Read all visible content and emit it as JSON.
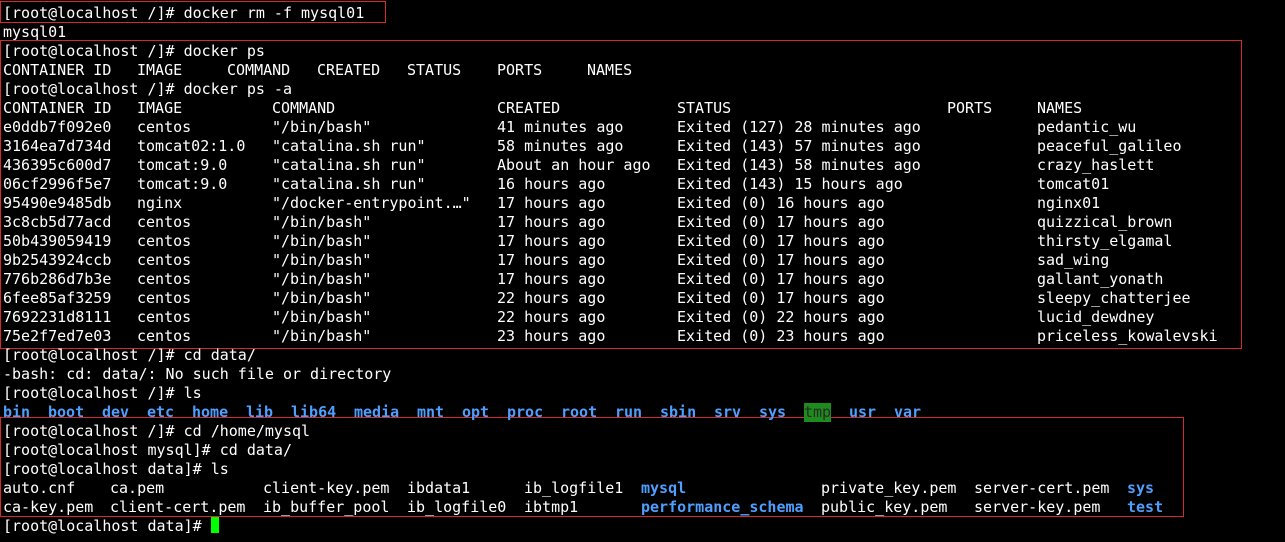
{
  "terminal": {
    "prompt_root": "[root@localhost /]#",
    "prompt_mysql": "[root@localhost mysql]#",
    "prompt_data": "[root@localhost data]#",
    "accent_color": "#d42a2a",
    "dir_color": "#4f9fff",
    "cursor_color": "#00ff00",
    "cmd_rm": "docker rm -f mysql01",
    "out_rm": "mysql01",
    "cmd_ps": "docker ps",
    "ps_headers": [
      "CONTAINER ID",
      "IMAGE",
      "COMMAND",
      "CREATED",
      "STATUS",
      "PORTS",
      "NAMES"
    ],
    "cmd_psa": "docker ps -a",
    "psa_headers": [
      "CONTAINER ID",
      "IMAGE",
      "COMMAND",
      "CREATED",
      "STATUS",
      "PORTS",
      "NAMES"
    ],
    "containers": [
      {
        "id": "e0ddb7f092e0",
        "image": "centos",
        "command": "\"/bin/bash\"",
        "created": "41 minutes ago",
        "status": "Exited (127) 28 minutes ago",
        "ports": "",
        "names": "pedantic_wu"
      },
      {
        "id": "3164ea7d734d",
        "image": "tomcat02:1.0",
        "command": "\"catalina.sh run\"",
        "created": "58 minutes ago",
        "status": "Exited (143) 57 minutes ago",
        "ports": "",
        "names": "peaceful_galileo"
      },
      {
        "id": "436395c600d7",
        "image": "tomcat:9.0",
        "command": "\"catalina.sh run\"",
        "created": "About an hour ago",
        "status": "Exited (143) 58 minutes ago",
        "ports": "",
        "names": "crazy_haslett"
      },
      {
        "id": "06cf2996f5e7",
        "image": "tomcat:9.0",
        "command": "\"catalina.sh run\"",
        "created": "16 hours ago",
        "status": "Exited (143) 15 hours ago",
        "ports": "",
        "names": "tomcat01"
      },
      {
        "id": "95490e9485db",
        "image": "nginx",
        "command": "\"/docker-entrypoint.…\"",
        "created": "17 hours ago",
        "status": "Exited (0) 16 hours ago",
        "ports": "",
        "names": "nginx01"
      },
      {
        "id": "3c8cb5d77acd",
        "image": "centos",
        "command": "\"/bin/bash\"",
        "created": "17 hours ago",
        "status": "Exited (0) 17 hours ago",
        "ports": "",
        "names": "quizzical_brown"
      },
      {
        "id": "50b439059419",
        "image": "centos",
        "command": "\"/bin/bash\"",
        "created": "17 hours ago",
        "status": "Exited (0) 17 hours ago",
        "ports": "",
        "names": "thirsty_elgamal"
      },
      {
        "id": "9b2543924ccb",
        "image": "centos",
        "command": "\"/bin/bash\"",
        "created": "17 hours ago",
        "status": "Exited (0) 17 hours ago",
        "ports": "",
        "names": "sad_wing"
      },
      {
        "id": "776b286d7b3e",
        "image": "centos",
        "command": "\"/bin/bash\"",
        "created": "17 hours ago",
        "status": "Exited (0) 17 hours ago",
        "ports": "",
        "names": "gallant_yonath"
      },
      {
        "id": "6fee85af3259",
        "image": "centos",
        "command": "\"/bin/bash\"",
        "created": "22 hours ago",
        "status": "Exited (0) 17 hours ago",
        "ports": "",
        "names": "sleepy_chatterjee"
      },
      {
        "id": "7692231d8111",
        "image": "centos",
        "command": "\"/bin/bash\"",
        "created": "22 hours ago",
        "status": "Exited (0) 22 hours ago",
        "ports": "",
        "names": "lucid_dewdney"
      },
      {
        "id": "75e2f7ed7e03",
        "image": "centos",
        "command": "\"/bin/bash\"",
        "created": "23 hours ago",
        "status": "Exited (0) 23 hours ago",
        "ports": "",
        "names": "priceless_kowalevski"
      }
    ],
    "cmd_cd_data": "cd data/",
    "err_cd": "-bash: cd: data/: No such file or directory",
    "cmd_ls": "ls",
    "root_dirs": [
      "bin",
      "boot",
      "dev",
      "etc",
      "home",
      "lib",
      "lib64",
      "media",
      "mnt",
      "opt",
      "proc",
      "root",
      "run",
      "sbin",
      "srv",
      "sys",
      "tmp",
      "usr",
      "var"
    ],
    "cmd_cd_mysql": "cd /home/mysql",
    "cmd_cd_data2": "cd data/",
    "cmd_ls2": "ls",
    "data_files_row1": [
      {
        "name": "auto.cnf",
        "dir": false
      },
      {
        "name": "ca.pem",
        "dir": false
      },
      {
        "name": "client-key.pem",
        "dir": false
      },
      {
        "name": "ibdata1",
        "dir": false
      },
      {
        "name": "ib_logfile1",
        "dir": false
      },
      {
        "name": "mysql",
        "dir": true
      },
      {
        "name": "private_key.pem",
        "dir": false
      },
      {
        "name": "server-cert.pem",
        "dir": false
      },
      {
        "name": "sys",
        "dir": true
      }
    ],
    "data_files_row2": [
      {
        "name": "ca-key.pem",
        "dir": false
      },
      {
        "name": "client-cert.pem",
        "dir": false
      },
      {
        "name": "ib_buffer_pool",
        "dir": false
      },
      {
        "name": "ib_logfile0",
        "dir": false
      },
      {
        "name": "ibtmp1",
        "dir": false
      },
      {
        "name": "performance_schema",
        "dir": true
      },
      {
        "name": "public_key.pem",
        "dir": false
      },
      {
        "name": "server-key.pem",
        "dir": false
      },
      {
        "name": "test",
        "dir": true
      }
    ]
  }
}
